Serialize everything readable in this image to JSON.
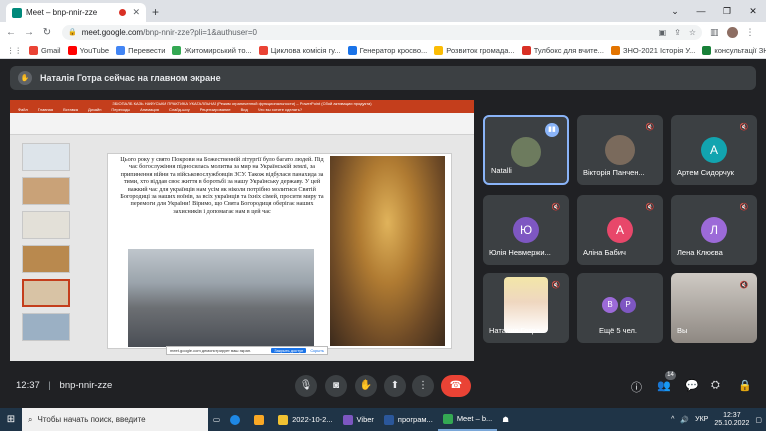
{
  "browser": {
    "tab_title": "Meet – bnp-nnir-zze",
    "url_host": "meet.google.com",
    "url_path": "/bnp-nnir-zze?pli=1&authuser=0",
    "bookmarks": [
      {
        "label": "Gmail",
        "color": "#ea4335"
      },
      {
        "label": "YouTube",
        "color": "#ff0000"
      },
      {
        "label": "Перевести",
        "color": "#4285f4"
      },
      {
        "label": "Житомирський то...",
        "color": "#34a853"
      },
      {
        "label": "Циклова комісія гу...",
        "color": "#ea4335"
      },
      {
        "label": "Генератор кросво...",
        "color": "#1a73e8"
      },
      {
        "label": "Розвиток громада...",
        "color": "#fbbc04"
      },
      {
        "label": "Тулбокс для вчите...",
        "color": "#d93025"
      },
      {
        "label": "ЗНО-2021 Історія У...",
        "color": "#e37400"
      },
      {
        "label": "консультації ЗНО",
        "color": "#188038"
      }
    ]
  },
  "meet": {
    "presenting_banner": "Наталія Готра сейчас на главном экране",
    "meeting_code": "bnp-nnir-zze",
    "time": "12:37",
    "participants_count": "14",
    "participants": [
      {
        "name": "Natalli",
        "type": "photo",
        "color": "#6d7b5e",
        "active": true
      },
      {
        "name": "Вікторія Панчен...",
        "type": "photo",
        "color": "#7a6a5c"
      },
      {
        "name": "Артем Сидорчук",
        "type": "letter",
        "letter": "А",
        "color": "#12a4af"
      },
      {
        "name": "Юлія Невмержи...",
        "type": "letter",
        "letter": "Ю",
        "color": "#7e57c2"
      },
      {
        "name": "Аліна Бабич",
        "type": "letter",
        "letter": "А",
        "color": "#e8476a"
      },
      {
        "name": "Лена Клюєва",
        "type": "letter",
        "letter": "Л",
        "color": "#9c6ad8"
      },
      {
        "name": "Наталия Готра",
        "type": "photo",
        "color": "#e9d6c4"
      },
      {
        "name": "Ещё 5 чел.",
        "type": "more",
        "letters": [
          "В",
          "Р"
        ]
      },
      {
        "name": "Вы",
        "type": "photo",
        "color": "#a6a09a"
      }
    ]
  },
  "slide": {
    "window_title": "ЗБІОПАЛБ КАЗЬ НАФУСЬКИ ПРАКТИКА УКАГАЛЛЬНАЇ (Режим ограниченной функциональности) – PowerPoint (Сбой активации продукта)",
    "ribbon_tabs": [
      "Файл",
      "Главная",
      "Вставка",
      "Дизайн",
      "Переходы",
      "Анимация",
      "Слайд-шоу",
      "Рецензирование",
      "Вид",
      "Что вы хотите сделать?"
    ],
    "text": "Цього року у свято Покрови на Божественній літургії було багато людей. Під час богослужіння підносилась молитва за мир на Українській землі, за припинення війни та військовослужбовців ЗСУ. Також відбулася панахида за тими, хто віддав своє життя в боротьбі за нашу Українську державу. У цей важкий час для українців нам усім як ніколи потрібно молитися Святій Богородиці за наших воїнів, за всіх українців та їхніх сімей, просити миру та перемоги для України! Віримо, що Свята Богородиця оберігає наших захисників і допомагає нам в цей час",
    "notification": "meet.google.com демонстрирует ваш экран.",
    "notification_action": "Закрыть доступ",
    "notification_hide": "Скрыть"
  },
  "taskbar": {
    "search_placeholder": "Чтобы начать поиск, введите",
    "items": [
      {
        "label": "2022-10-2...",
        "color": "#f1c232"
      },
      {
        "label": "Viber",
        "color": "#7d57c1"
      },
      {
        "label": "програм...",
        "color": "#2b579a"
      },
      {
        "label": "Meet – b...",
        "color": "#34a853"
      }
    ],
    "lang": "УКР",
    "clock_time": "12:37",
    "clock_date": "25.10.2022"
  }
}
